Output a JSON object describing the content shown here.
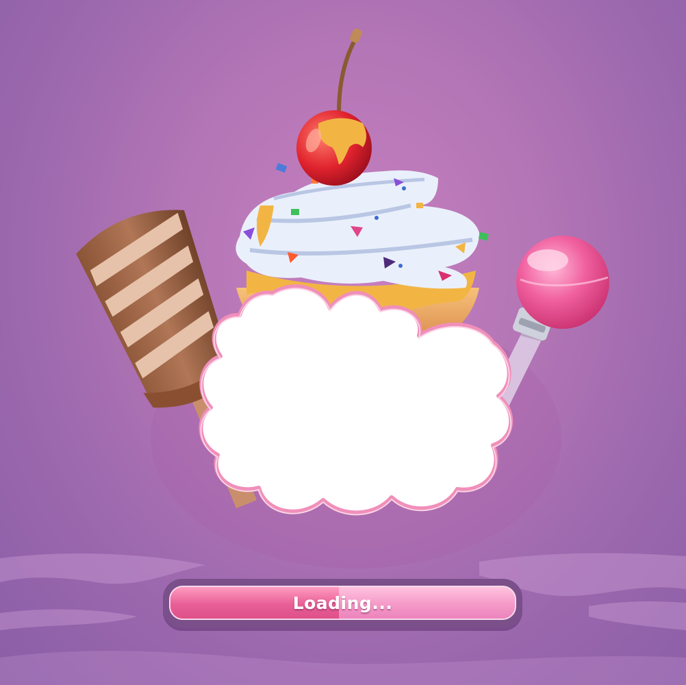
{
  "loading": {
    "label": "Loading...",
    "progress": 0.49,
    "fill_color": "#e85f96",
    "track_color": "#f59ac8",
    "frame_color": "#7a4f8a"
  },
  "name_panel": {
    "text": ""
  },
  "decorations": {
    "background_color": "#b476b6",
    "items": [
      "cupcake",
      "cherry",
      "whipped-cream",
      "chocolate-ice-cream-bar",
      "lollipop",
      "cloud-frame"
    ]
  }
}
